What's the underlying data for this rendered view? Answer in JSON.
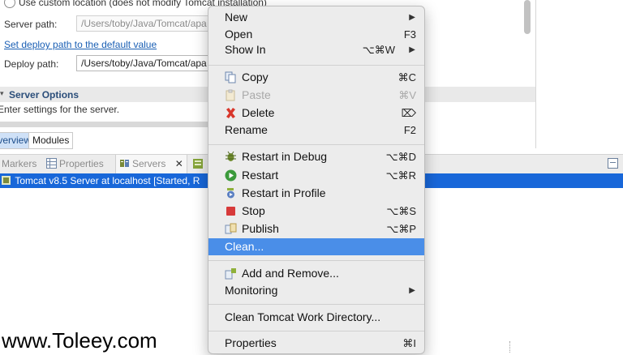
{
  "editor": {
    "custom_location": "Use custom location (does not modify Tomcat installation)",
    "server_path_label": "Server path:",
    "server_path_value": "/Users/toby/Java/Tomcat/apa",
    "set_default_link": "Set deploy path to the default value",
    "deploy_path_label": "Deploy path:",
    "deploy_path_value": "/Users/toby/Java/Tomcat/apa",
    "server_options_title": "Server Options",
    "server_options_desc": "Enter settings for the server.",
    "tab_overview": "Overview",
    "tab_modules": "Modules"
  },
  "views": {
    "tabs": [
      {
        "label": "Markers"
      },
      {
        "label": "Properties"
      },
      {
        "label": "Servers"
      }
    ],
    "server_row": "Tomcat v8.5 Server at localhost  [Started, R"
  },
  "menu": {
    "new": {
      "label": "New"
    },
    "open": {
      "label": "Open",
      "shortcut": "F3"
    },
    "show_in": {
      "label": "Show In",
      "shortcut": "⌥⌘W"
    },
    "copy": {
      "label": "Copy",
      "shortcut": "⌘C"
    },
    "paste": {
      "label": "Paste",
      "shortcut": "⌘V"
    },
    "delete": {
      "label": "Delete",
      "shortcut": "⌦"
    },
    "rename": {
      "label": "Rename",
      "shortcut": "F2"
    },
    "restart_debug": {
      "label": "Restart in Debug",
      "shortcut": "⌥⌘D"
    },
    "restart": {
      "label": "Restart",
      "shortcut": "⌥⌘R"
    },
    "restart_profile": {
      "label": "Restart in Profile"
    },
    "stop": {
      "label": "Stop",
      "shortcut": "⌥⌘S"
    },
    "publish": {
      "label": "Publish",
      "shortcut": "⌥⌘P"
    },
    "clean": {
      "label": "Clean..."
    },
    "add_remove": {
      "label": "Add and Remove..."
    },
    "monitoring": {
      "label": "Monitoring"
    },
    "clean_tomcat": {
      "label": "Clean Tomcat Work Directory..."
    },
    "properties": {
      "label": "Properties",
      "shortcut": "⌘I"
    }
  },
  "watermark": "www.Toleey.com",
  "colors": {
    "selection": "#4a8ee8",
    "server_row": "#1867d9",
    "menu_bg": "#ececec"
  }
}
